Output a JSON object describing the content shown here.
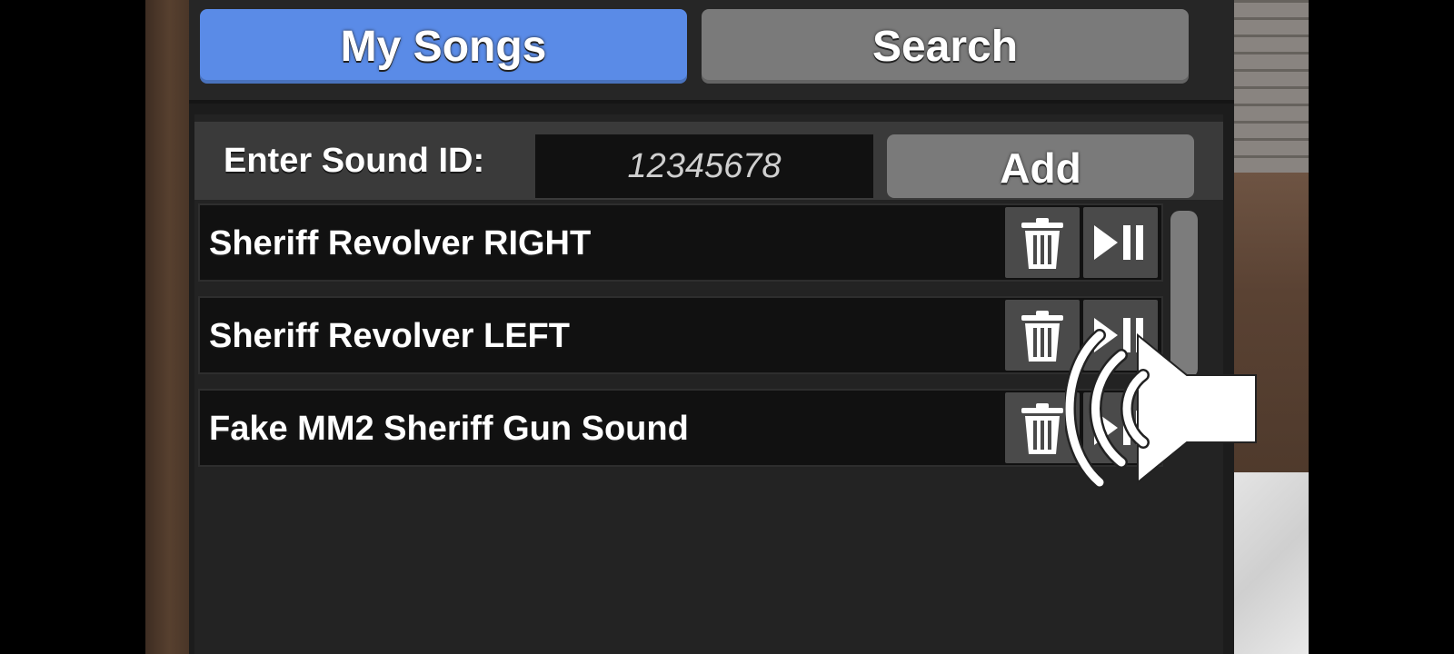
{
  "tabs": {
    "my_songs": "My Songs",
    "search": "Search"
  },
  "sound_id": {
    "label": "Enter Sound ID:",
    "value": "12345678",
    "add_label": "Add"
  },
  "songs": [
    {
      "title": "Sheriff Revolver RIGHT"
    },
    {
      "title": "Sheriff Revolver LEFT"
    },
    {
      "title": "Fake MM2 Sheriff Gun Sound"
    }
  ],
  "colors": {
    "active_tab": "#5a8be7",
    "inactive_button": "#7a7a7a",
    "panel_background": "#1c1c1c",
    "row_background": "#111111"
  },
  "icons": {
    "delete": "trash-icon",
    "play_pause": "play-pause-icon",
    "overlay": "volume-speaker-icon"
  }
}
